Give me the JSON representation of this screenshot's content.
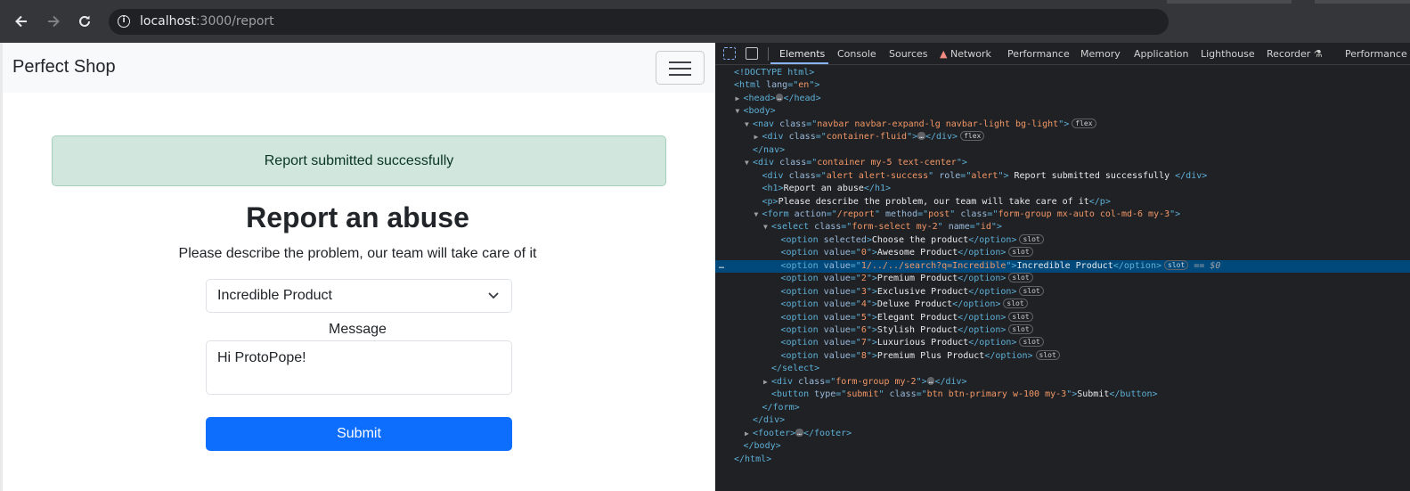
{
  "browser": {
    "url_host": "localhost",
    "url_rest": ":3000/report"
  },
  "page": {
    "brand": "Perfect Shop",
    "alert": "Report submitted successfully",
    "heading": "Report an abuse",
    "lead": "Please describe the problem, our team will take care of it",
    "select_value": "Incredible Product",
    "message_label": "Message",
    "message_value": "Hi ProtoPope!",
    "submit_label": "Submit"
  },
  "devtools": {
    "tabs": [
      "Elements",
      "Console",
      "Sources",
      "Network",
      "Performance",
      "Memory",
      "Application",
      "Lighthouse",
      "Recorder",
      "Performance"
    ],
    "badge_flex": "flex",
    "badge_slot": "slot",
    "selected_marker": "== $0",
    "ellipsis": "…",
    "gutter_dots": "…",
    "lines": [
      {
        "indent": 0,
        "tw": "",
        "html": [
          {
            "c": "t",
            "s": "<!DOCTYPE html>"
          }
        ]
      },
      {
        "indent": 0,
        "tw": "",
        "html": [
          {
            "c": "t",
            "s": "<html "
          },
          {
            "c": "an",
            "s": "lang"
          },
          {
            "c": "t",
            "s": "=\""
          },
          {
            "c": "av",
            "s": "en"
          },
          {
            "c": "t",
            "s": "\">"
          }
        ]
      },
      {
        "indent": 1,
        "tw": "▶",
        "html": [
          {
            "c": "t",
            "s": "<head>"
          },
          {
            "c": "dots",
            "s": "…"
          },
          {
            "c": "t",
            "s": "</head>"
          }
        ]
      },
      {
        "indent": 1,
        "tw": "▼",
        "html": [
          {
            "c": "t",
            "s": "<body>"
          }
        ]
      },
      {
        "indent": 2,
        "tw": "▼",
        "html": [
          {
            "c": "t",
            "s": "<nav "
          },
          {
            "c": "an",
            "s": "class"
          },
          {
            "c": "t",
            "s": "=\""
          },
          {
            "c": "av",
            "s": "navbar navbar-expand-lg navbar-light bg-light"
          },
          {
            "c": "t",
            "s": "\">"
          },
          {
            "c": "badge",
            "s": "flex"
          }
        ]
      },
      {
        "indent": 3,
        "tw": "▶",
        "html": [
          {
            "c": "t",
            "s": "<div "
          },
          {
            "c": "an",
            "s": "class"
          },
          {
            "c": "t",
            "s": "=\""
          },
          {
            "c": "av",
            "s": "container-fluid"
          },
          {
            "c": "t",
            "s": "\">"
          },
          {
            "c": "dots",
            "s": "…"
          },
          {
            "c": "t",
            "s": "</div>"
          },
          {
            "c": "badge",
            "s": "flex"
          }
        ]
      },
      {
        "indent": 2,
        "tw": "",
        "html": [
          {
            "c": "t",
            "s": "</nav>"
          }
        ]
      },
      {
        "indent": 2,
        "tw": "▼",
        "html": [
          {
            "c": "t",
            "s": "<div "
          },
          {
            "c": "an",
            "s": "class"
          },
          {
            "c": "t",
            "s": "=\""
          },
          {
            "c": "av",
            "s": "container my-5 text-center"
          },
          {
            "c": "t",
            "s": "\">"
          }
        ]
      },
      {
        "indent": 3,
        "tw": "",
        "html": [
          {
            "c": "t",
            "s": "<div "
          },
          {
            "c": "an",
            "s": "class"
          },
          {
            "c": "t",
            "s": "=\""
          },
          {
            "c": "av",
            "s": "alert alert-success"
          },
          {
            "c": "t",
            "s": "\" "
          },
          {
            "c": "an",
            "s": "role"
          },
          {
            "c": "t",
            "s": "=\""
          },
          {
            "c": "av",
            "s": "alert"
          },
          {
            "c": "t",
            "s": "\">"
          },
          {
            "c": "tx",
            "s": " Report submitted successfully "
          },
          {
            "c": "t",
            "s": "</div>"
          }
        ]
      },
      {
        "indent": 3,
        "tw": "",
        "html": [
          {
            "c": "t",
            "s": "<h1>"
          },
          {
            "c": "tx",
            "s": "Report an abuse"
          },
          {
            "c": "t",
            "s": "</h1>"
          }
        ]
      },
      {
        "indent": 3,
        "tw": "",
        "html": [
          {
            "c": "t",
            "s": "<p>"
          },
          {
            "c": "tx",
            "s": "Please describe the problem, our team will take care of it"
          },
          {
            "c": "t",
            "s": "</p>"
          }
        ]
      },
      {
        "indent": 3,
        "tw": "▼",
        "html": [
          {
            "c": "t",
            "s": "<form "
          },
          {
            "c": "an",
            "s": "action"
          },
          {
            "c": "t",
            "s": "=\""
          },
          {
            "c": "av",
            "s": "/report"
          },
          {
            "c": "t",
            "s": "\" "
          },
          {
            "c": "an",
            "s": "method"
          },
          {
            "c": "t",
            "s": "=\""
          },
          {
            "c": "av",
            "s": "post"
          },
          {
            "c": "t",
            "s": "\" "
          },
          {
            "c": "an",
            "s": "class"
          },
          {
            "c": "t",
            "s": "=\""
          },
          {
            "c": "av",
            "s": "form-group mx-auto col-md-6 my-3"
          },
          {
            "c": "t",
            "s": "\">"
          }
        ]
      },
      {
        "indent": 4,
        "tw": "▼",
        "html": [
          {
            "c": "t",
            "s": "<select "
          },
          {
            "c": "an",
            "s": "class"
          },
          {
            "c": "t",
            "s": "=\""
          },
          {
            "c": "av",
            "s": "form-select my-2"
          },
          {
            "c": "t",
            "s": "\" "
          },
          {
            "c": "an",
            "s": "name"
          },
          {
            "c": "t",
            "s": "=\""
          },
          {
            "c": "av",
            "s": "id"
          },
          {
            "c": "t",
            "s": "\">"
          }
        ]
      },
      {
        "indent": 5,
        "tw": "",
        "html": [
          {
            "c": "t",
            "s": "<option "
          },
          {
            "c": "an",
            "s": "selected"
          },
          {
            "c": "t",
            "s": ">"
          },
          {
            "c": "tx",
            "s": "Choose the product"
          },
          {
            "c": "t",
            "s": "</option>"
          },
          {
            "c": "badge",
            "s": "slot"
          }
        ]
      },
      {
        "indent": 5,
        "tw": "",
        "html": [
          {
            "c": "t",
            "s": "<option "
          },
          {
            "c": "an",
            "s": "value"
          },
          {
            "c": "t",
            "s": "=\""
          },
          {
            "c": "av",
            "s": "0"
          },
          {
            "c": "t",
            "s": "\">"
          },
          {
            "c": "tx",
            "s": "Awesome Product"
          },
          {
            "c": "t",
            "s": "</option>"
          },
          {
            "c": "badge",
            "s": "slot"
          }
        ]
      },
      {
        "indent": 5,
        "tw": "",
        "hl": true,
        "html": [
          {
            "c": "t",
            "s": "<option "
          },
          {
            "c": "an",
            "s": "value"
          },
          {
            "c": "t",
            "s": "=\""
          },
          {
            "c": "av",
            "s": "1/../../search?q=Incredible"
          },
          {
            "c": "t",
            "s": "\">"
          },
          {
            "c": "tx",
            "s": "Incredible Product"
          },
          {
            "c": "t",
            "s": "</option>"
          },
          {
            "c": "badge",
            "s": "slot"
          },
          {
            "c": "eq",
            "s": " == $0"
          }
        ]
      },
      {
        "indent": 5,
        "tw": "",
        "html": [
          {
            "c": "t",
            "s": "<option "
          },
          {
            "c": "an",
            "s": "value"
          },
          {
            "c": "t",
            "s": "=\""
          },
          {
            "c": "av",
            "s": "2"
          },
          {
            "c": "t",
            "s": "\">"
          },
          {
            "c": "tx",
            "s": "Premium Product"
          },
          {
            "c": "t",
            "s": "</option>"
          },
          {
            "c": "badge",
            "s": "slot"
          }
        ]
      },
      {
        "indent": 5,
        "tw": "",
        "html": [
          {
            "c": "t",
            "s": "<option "
          },
          {
            "c": "an",
            "s": "value"
          },
          {
            "c": "t",
            "s": "=\""
          },
          {
            "c": "av",
            "s": "3"
          },
          {
            "c": "t",
            "s": "\">"
          },
          {
            "c": "tx",
            "s": "Exclusive Product"
          },
          {
            "c": "t",
            "s": "</option>"
          },
          {
            "c": "badge",
            "s": "slot"
          }
        ]
      },
      {
        "indent": 5,
        "tw": "",
        "html": [
          {
            "c": "t",
            "s": "<option "
          },
          {
            "c": "an",
            "s": "value"
          },
          {
            "c": "t",
            "s": "=\""
          },
          {
            "c": "av",
            "s": "4"
          },
          {
            "c": "t",
            "s": "\">"
          },
          {
            "c": "tx",
            "s": "Deluxe Product"
          },
          {
            "c": "t",
            "s": "</option>"
          },
          {
            "c": "badge",
            "s": "slot"
          }
        ]
      },
      {
        "indent": 5,
        "tw": "",
        "html": [
          {
            "c": "t",
            "s": "<option "
          },
          {
            "c": "an",
            "s": "value"
          },
          {
            "c": "t",
            "s": "=\""
          },
          {
            "c": "av",
            "s": "5"
          },
          {
            "c": "t",
            "s": "\">"
          },
          {
            "c": "tx",
            "s": "Elegant Product"
          },
          {
            "c": "t",
            "s": "</option>"
          },
          {
            "c": "badge",
            "s": "slot"
          }
        ]
      },
      {
        "indent": 5,
        "tw": "",
        "html": [
          {
            "c": "t",
            "s": "<option "
          },
          {
            "c": "an",
            "s": "value"
          },
          {
            "c": "t",
            "s": "=\""
          },
          {
            "c": "av",
            "s": "6"
          },
          {
            "c": "t",
            "s": "\">"
          },
          {
            "c": "tx",
            "s": "Stylish Product"
          },
          {
            "c": "t",
            "s": "</option>"
          },
          {
            "c": "badge",
            "s": "slot"
          }
        ]
      },
      {
        "indent": 5,
        "tw": "",
        "html": [
          {
            "c": "t",
            "s": "<option "
          },
          {
            "c": "an",
            "s": "value"
          },
          {
            "c": "t",
            "s": "=\""
          },
          {
            "c": "av",
            "s": "7"
          },
          {
            "c": "t",
            "s": "\">"
          },
          {
            "c": "tx",
            "s": "Luxurious Product"
          },
          {
            "c": "t",
            "s": "</option>"
          },
          {
            "c": "badge",
            "s": "slot"
          }
        ]
      },
      {
        "indent": 5,
        "tw": "",
        "html": [
          {
            "c": "t",
            "s": "<option "
          },
          {
            "c": "an",
            "s": "value"
          },
          {
            "c": "t",
            "s": "=\""
          },
          {
            "c": "av",
            "s": "8"
          },
          {
            "c": "t",
            "s": "\">"
          },
          {
            "c": "tx",
            "s": "Premium Plus Product"
          },
          {
            "c": "t",
            "s": "</option>"
          },
          {
            "c": "badge",
            "s": "slot"
          }
        ]
      },
      {
        "indent": 4,
        "tw": "",
        "html": [
          {
            "c": "t",
            "s": "</select>"
          }
        ]
      },
      {
        "indent": 4,
        "tw": "▶",
        "html": [
          {
            "c": "t",
            "s": "<div "
          },
          {
            "c": "an",
            "s": "class"
          },
          {
            "c": "t",
            "s": "=\""
          },
          {
            "c": "av",
            "s": "form-group my-2"
          },
          {
            "c": "t",
            "s": "\">"
          },
          {
            "c": "dots",
            "s": "…"
          },
          {
            "c": "t",
            "s": "</div>"
          }
        ]
      },
      {
        "indent": 4,
        "tw": "",
        "html": [
          {
            "c": "t",
            "s": "<button "
          },
          {
            "c": "an",
            "s": "type"
          },
          {
            "c": "t",
            "s": "=\""
          },
          {
            "c": "av",
            "s": "submit"
          },
          {
            "c": "t",
            "s": "\" "
          },
          {
            "c": "an",
            "s": "class"
          },
          {
            "c": "t",
            "s": "=\""
          },
          {
            "c": "av",
            "s": "btn btn-primary w-100 my-3"
          },
          {
            "c": "t",
            "s": "\">"
          },
          {
            "c": "tx",
            "s": "Submit"
          },
          {
            "c": "t",
            "s": "</button>"
          }
        ]
      },
      {
        "indent": 3,
        "tw": "",
        "html": [
          {
            "c": "t",
            "s": "</form>"
          }
        ]
      },
      {
        "indent": 2,
        "tw": "",
        "html": [
          {
            "c": "t",
            "s": "</div>"
          }
        ]
      },
      {
        "indent": 2,
        "tw": "▶",
        "html": [
          {
            "c": "t",
            "s": "<footer>"
          },
          {
            "c": "dots",
            "s": "…"
          },
          {
            "c": "t",
            "s": "</footer>"
          }
        ]
      },
      {
        "indent": 1,
        "tw": "",
        "html": [
          {
            "c": "t",
            "s": "</body>"
          }
        ]
      },
      {
        "indent": 0,
        "tw": "",
        "html": [
          {
            "c": "t",
            "s": "</html>"
          }
        ]
      }
    ]
  }
}
